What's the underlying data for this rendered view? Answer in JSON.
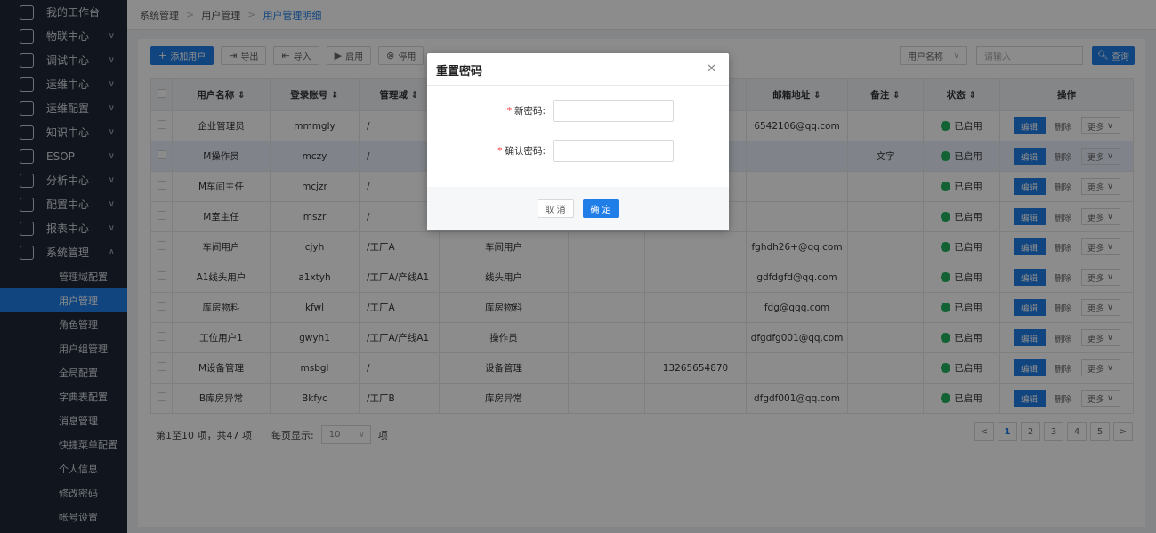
{
  "sidebar": {
    "menu": [
      {
        "label": "我的工作台",
        "icon": "monitor-icon",
        "has_chevron": false
      },
      {
        "label": "物联中心",
        "icon": "antenna-icon",
        "has_chevron": true
      },
      {
        "label": "调试中心",
        "icon": "debug-icon",
        "has_chevron": true
      },
      {
        "label": "运维中心",
        "icon": "home-icon",
        "has_chevron": true
      },
      {
        "label": "运维配置",
        "icon": "gear-icon",
        "has_chevron": true
      },
      {
        "label": "知识中心",
        "icon": "book-icon",
        "has_chevron": true
      },
      {
        "label": "ESOP",
        "icon": "esop-icon",
        "has_chevron": true
      },
      {
        "label": "分析中心",
        "icon": "chart-icon",
        "has_chevron": true
      },
      {
        "label": "配置中心",
        "icon": "config-icon",
        "has_chevron": true
      },
      {
        "label": "报表中心",
        "icon": "report-icon",
        "has_chevron": true
      },
      {
        "label": "系统管理",
        "icon": "settings-icon",
        "has_chevron": true
      }
    ],
    "submenu": [
      {
        "label": "管理域配置",
        "active": false
      },
      {
        "label": "用户管理",
        "active": true
      },
      {
        "label": "角色管理",
        "active": false
      },
      {
        "label": "用户组管理",
        "active": false
      },
      {
        "label": "全局配置",
        "active": false
      },
      {
        "label": "字典表配置",
        "active": false
      },
      {
        "label": "消息管理",
        "active": false
      },
      {
        "label": "快捷菜单配置",
        "active": false
      },
      {
        "label": "个人信息",
        "active": false
      },
      {
        "label": "修改密码",
        "active": false
      },
      {
        "label": "帐号设置",
        "active": false
      }
    ]
  },
  "breadcrumb": [
    "系统管理",
    "用户管理",
    "用户管理明细"
  ],
  "toolbar": {
    "add": "添加用户",
    "export": "导出",
    "import": "导入",
    "enable": "启用",
    "disable": "停用"
  },
  "search": {
    "field": "用户名称",
    "placeholder": "请输入",
    "button": "查询"
  },
  "table": {
    "headers": [
      "用户名称",
      "登录账号",
      "管理域",
      "",
      "",
      "",
      "邮箱地址",
      "备注",
      "状态",
      "操作"
    ],
    "rows": [
      {
        "name": "企业管理员",
        "account": "mmmgly",
        "domain": "/",
        "role": "",
        "c5": "",
        "phone": "",
        "email": "6542106@qq.com",
        "note": "",
        "status": "已启用"
      },
      {
        "name": "M操作员",
        "account": "mczy",
        "domain": "/",
        "role": "",
        "c5": "",
        "phone": "",
        "email": "",
        "note": "文字",
        "status": "已启用"
      },
      {
        "name": "M车间主任",
        "account": "mcjzr",
        "domain": "/",
        "role": "",
        "c5": "",
        "phone": "",
        "email": "",
        "note": "",
        "status": "已启用"
      },
      {
        "name": "M室主任",
        "account": "mszr",
        "domain": "/",
        "role": "",
        "c5": "",
        "phone": "",
        "email": "",
        "note": "",
        "status": "已启用"
      },
      {
        "name": "车间用户",
        "account": "cjyh",
        "domain": "/工厂A",
        "role": "车间用户",
        "c5": "",
        "phone": "",
        "email": "fghdh26+@qq.com",
        "note": "",
        "status": "已启用"
      },
      {
        "name": "A1线头用户",
        "account": "a1xtyh",
        "domain": "/工厂A/产线A1",
        "role": "线头用户",
        "c5": "",
        "phone": "",
        "email": "gdfdgfd@qq.com",
        "note": "",
        "status": "已启用"
      },
      {
        "name": "库房物料",
        "account": "kfwl",
        "domain": "/工厂A",
        "role": "库房物料",
        "c5": "",
        "phone": "",
        "email": "fdg@qqq.com",
        "note": "",
        "status": "已启用"
      },
      {
        "name": "工位用户1",
        "account": "gwyh1",
        "domain": "/工厂A/产线A1",
        "role": "操作员",
        "c5": "",
        "phone": "",
        "email": "dfgdfg001@qq.com",
        "note": "",
        "status": "已启用"
      },
      {
        "name": "M设备管理",
        "account": "msbgl",
        "domain": "/",
        "role": "设备管理",
        "c5": "",
        "phone": "13265654870",
        "email": "",
        "note": "",
        "status": "已启用"
      },
      {
        "name": "B库房异常",
        "account": "Bkfyc",
        "domain": "/工厂B",
        "role": "库房异常",
        "c5": "",
        "phone": "",
        "email": "dfgdf001@qq.com",
        "note": "",
        "status": "已启用"
      }
    ],
    "actions": {
      "edit": "编辑",
      "delete": "删除",
      "more": "更多"
    }
  },
  "footer": {
    "summary": "第1至10 项，共47 项",
    "per_page_label": "每页显示:",
    "per_page_value": "10",
    "per_page_unit": "项",
    "pages": [
      "1",
      "2",
      "3",
      "4",
      "5"
    ],
    "current_page": "1"
  },
  "modal": {
    "title": "重置密码",
    "new_password_label": "新密码:",
    "confirm_password_label": "确认密码:",
    "required_mark": "*",
    "cancel": "取 消",
    "ok": "确 定"
  },
  "colors": {
    "primary": "#1f7ee8",
    "sidebar": "#1f2937",
    "success": "#22b35e"
  }
}
